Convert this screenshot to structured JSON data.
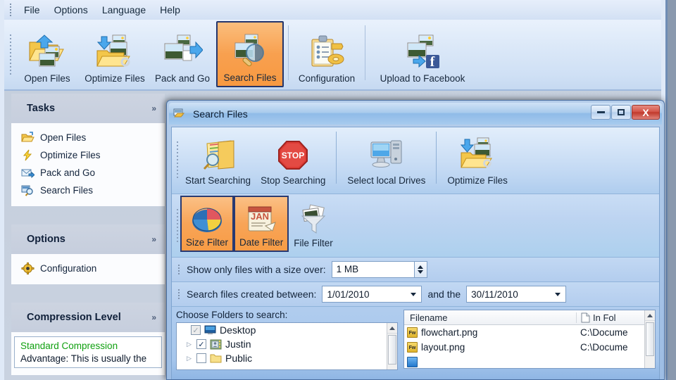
{
  "app": {
    "menu": [
      {
        "label": "File"
      },
      {
        "label": "Options"
      },
      {
        "label": "Language"
      },
      {
        "label": "Help"
      }
    ],
    "toolbar": [
      {
        "label": "Open Files",
        "icon": "open-files-icon",
        "active": false
      },
      {
        "label": "Optimize Files",
        "icon": "optimize-files-icon",
        "active": false
      },
      {
        "label": "Pack and Go",
        "icon": "pack-and-go-icon",
        "active": false
      },
      {
        "label": "Search Files",
        "icon": "search-files-icon",
        "active": true
      },
      {
        "label": "Configuration",
        "icon": "configuration-icon",
        "active": false
      },
      {
        "label": "Upload to Facebook",
        "icon": "upload-facebook-icon",
        "active": false
      }
    ]
  },
  "sidebar": {
    "tasks": {
      "title": "Tasks",
      "chevron": "»",
      "items": [
        {
          "label": "Open Files",
          "icon": "folder-open-icon"
        },
        {
          "label": "Optimize Files",
          "icon": "lightning-icon"
        },
        {
          "label": "Pack and Go",
          "icon": "envelope-icon"
        },
        {
          "label": "Search Files",
          "icon": "magnifier-icon"
        }
      ]
    },
    "options": {
      "title": "Options",
      "chevron": "»",
      "items": [
        {
          "label": "Configuration",
          "icon": "gear-icon"
        }
      ]
    },
    "compression": {
      "title": "Compression Level",
      "chevron": "»",
      "level_name": "Standard Compression",
      "description": "Advantage: This is usually the"
    }
  },
  "dialog": {
    "title": "Search Files",
    "icon": "search-files-window-icon",
    "window_buttons": {
      "minimize": "—",
      "maximize": "□",
      "close": "X"
    },
    "toolbar": [
      {
        "label": "Start Searching",
        "icon": "start-searching-icon",
        "active": false
      },
      {
        "label": "Stop Searching",
        "icon": "stop-searching-icon",
        "active": false
      },
      {
        "label": "Select local Drives",
        "icon": "select-local-drives-icon",
        "active": false
      },
      {
        "label": "Optimize Files",
        "icon": "optimize-files-icon",
        "active": false
      }
    ],
    "filters": [
      {
        "label": "Size Filter",
        "icon": "pie-chart-icon",
        "active": true
      },
      {
        "label": "Date Filter",
        "icon": "calendar-icon",
        "active": true
      },
      {
        "label": "File Filter",
        "icon": "funnel-icon",
        "active": false
      }
    ],
    "size_filter": {
      "label": "Show only files with a size over:",
      "value": "1 MB"
    },
    "date_filter": {
      "label": "Search files created between:",
      "from_value": "1/01/2010",
      "middle_label": "and the",
      "to_value": "30/11/2010"
    },
    "folders": {
      "label": "Choose Folders to search:",
      "tree": [
        {
          "label": "Desktop",
          "checked": true,
          "disabled": true,
          "expandable": false,
          "indent": 0,
          "icon": "desktop-icon"
        },
        {
          "label": "Justin",
          "checked": true,
          "disabled": false,
          "expandable": true,
          "indent": 1,
          "icon": "user-folder-icon"
        },
        {
          "label": "Public",
          "checked": false,
          "disabled": false,
          "expandable": true,
          "indent": 1,
          "icon": "folder-icon"
        }
      ]
    },
    "results": {
      "columns": [
        {
          "label": "Filename"
        },
        {
          "label": "In Fol",
          "icon": "file-icon"
        }
      ],
      "rows": [
        {
          "filename": "flowchart.png",
          "folder": "C:\\Docume",
          "icon": "fw-png-icon"
        },
        {
          "filename": "layout.png",
          "folder": "C:\\Docume",
          "icon": "fw-png-icon"
        },
        {
          "filename": "",
          "folder": "",
          "icon": "blue-file-icon"
        }
      ]
    }
  },
  "colors": {
    "accent_orange": "#f79941",
    "title_blue": "#8fbbe8",
    "close_red": "#c0392c",
    "green_text": "#10a010"
  }
}
